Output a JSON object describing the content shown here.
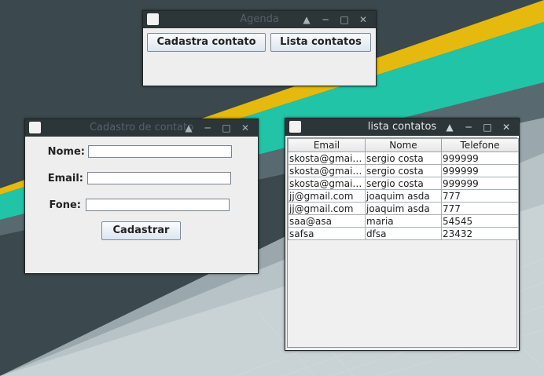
{
  "agenda_window": {
    "title": "Agenda",
    "cadastra_button": "Cadastra contato",
    "lista_button": "Lista contatos"
  },
  "cadastro_window": {
    "title": "Cadastro de contato",
    "nome_label": "Nome:",
    "email_label": "Email:",
    "fone_label": "Fone:",
    "nome_value": "",
    "email_value": "",
    "fone_value": "",
    "submit_button": "Cadastrar"
  },
  "lista_window": {
    "title": "lista contatos",
    "columns": [
      "Email",
      "Nome",
      "Telefone"
    ],
    "rows": [
      [
        "skosta@gmail...",
        "sergio costa",
        "999999"
      ],
      [
        "skosta@gmail...",
        "sergio costa",
        "999999"
      ],
      [
        "skosta@gmail...",
        "sergio costa",
        "999999"
      ],
      [
        "jj@gmail.com",
        "joaquim asda",
        "777"
      ],
      [
        "jj@gmail.com",
        "joaquim asda",
        "777"
      ],
      [
        "saa@asa",
        "maria",
        "54545"
      ],
      [
        "safsa",
        "dfsa",
        "23432"
      ]
    ]
  },
  "window_controls": [
    "shade-icon",
    "minimize-icon",
    "maximize-icon",
    "close-icon"
  ],
  "colors": {
    "desktop_dark": "#3c4a4f",
    "stripe_yellow": "#e6b90f",
    "stripe_teal": "#20c4a6",
    "panel_light": "#c9d1d4",
    "titlebar": "#2c3538",
    "window_bg": "#eeeeee"
  }
}
